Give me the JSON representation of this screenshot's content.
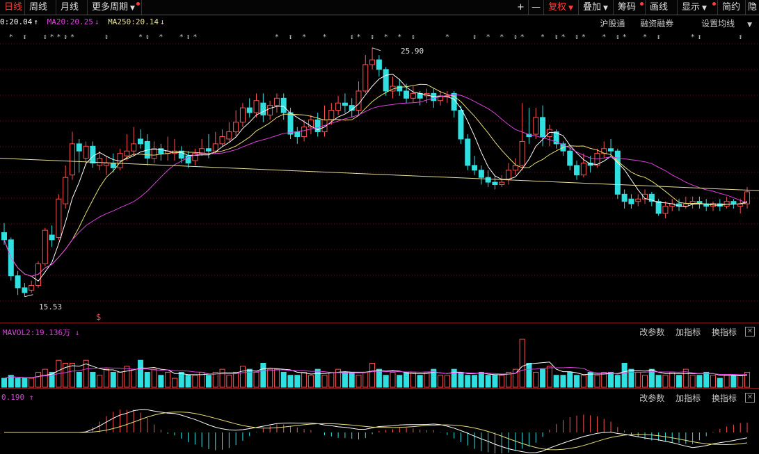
{
  "toolbar": {
    "left_tabs": [
      "日线",
      "周线",
      "月线",
      "更多周期"
    ],
    "right_tabs": [
      "+",
      "—",
      "复权",
      "叠加",
      "筹码",
      "画线",
      "显示",
      "简约",
      "隐"
    ]
  },
  "main_legend": {
    "ma5": "0:20.04",
    "ma20": "MA20:20.25",
    "ma250": "MA250:20.14",
    "arrow_up": "↑",
    "arrow_down": "↓"
  },
  "main_links": [
    "沪股通",
    "融资融券",
    "设置均线"
  ],
  "price_labels": {
    "high": "25.90",
    "low": "15.53"
  },
  "s_mark": "$",
  "vol_panel": {
    "label": "MAVOL2:19.136万",
    "arrow": "↓",
    "actions": [
      "改参数",
      "加指标",
      "换指标"
    ]
  },
  "ind_panel": {
    "label": "0.190",
    "arrow": "↑",
    "actions": [
      "改参数",
      "加指标",
      "换指标"
    ]
  },
  "colors": {
    "up": "#ff5050",
    "down": "#30e0e0",
    "ma5": "#ffffff",
    "ma10": "#e8e07a",
    "ma20": "#e040e0",
    "ma250": "#e8e0a0"
  },
  "chart_data": {
    "type": "candlestick",
    "candles": [
      [
        18.2,
        17.9,
        18.6,
        17.7
      ],
      [
        17.9,
        16.4,
        18.0,
        16.2
      ],
      [
        16.4,
        15.9,
        16.6,
        15.6
      ],
      [
        15.9,
        15.7,
        16.1,
        15.53
      ],
      [
        15.8,
        16.0,
        16.2,
        15.7
      ],
      [
        16.0,
        16.9,
        17.0,
        15.9
      ],
      [
        16.9,
        18.3,
        18.4,
        16.8
      ],
      [
        18.1,
        17.9,
        18.5,
        17.6
      ],
      [
        18.0,
        19.6,
        19.8,
        17.9
      ],
      [
        19.4,
        20.5,
        21.0,
        19.2
      ],
      [
        20.6,
        21.9,
        22.4,
        20.4
      ],
      [
        21.9,
        21.6,
        22.1,
        20.7
      ],
      [
        21.3,
        21.8,
        22.0,
        21.0
      ],
      [
        21.8,
        21.1,
        22.0,
        20.9
      ],
      [
        21.0,
        21.3,
        21.6,
        20.8
      ],
      [
        21.0,
        21.1,
        21.4,
        20.6
      ],
      [
        21.1,
        20.9,
        21.5,
        20.7
      ],
      [
        20.9,
        21.5,
        21.7,
        20.8
      ],
      [
        21.4,
        21.6,
        22.3,
        21.2
      ],
      [
        21.6,
        21.9,
        22.6,
        21.4
      ],
      [
        22.1,
        21.9,
        22.5,
        21.7
      ],
      [
        22.0,
        21.3,
        22.3,
        21.0
      ],
      [
        21.3,
        21.7,
        22.0,
        21.1
      ],
      [
        21.7,
        21.5,
        21.9,
        21.2
      ],
      [
        21.5,
        21.6,
        22.2,
        21.2
      ],
      [
        21.5,
        21.6,
        22.1,
        21.2
      ],
      [
        21.6,
        21.3,
        21.8,
        21.1
      ],
      [
        21.4,
        21.1,
        21.6,
        20.9
      ],
      [
        21.2,
        21.5,
        21.7,
        21.0
      ],
      [
        21.5,
        21.7,
        22.1,
        21.4
      ],
      [
        21.7,
        21.6,
        22.3,
        21.3
      ],
      [
        21.6,
        21.9,
        22.4,
        21.5
      ],
      [
        21.9,
        22.2,
        22.5,
        21.8
      ],
      [
        22.1,
        22.4,
        22.8,
        22.0
      ],
      [
        22.4,
        22.8,
        23.3,
        22.2
      ],
      [
        22.8,
        23.4,
        23.6,
        22.6
      ],
      [
        23.4,
        23.2,
        23.8,
        23.0
      ],
      [
        23.2,
        23.7,
        24.0,
        23.0
      ],
      [
        23.6,
        23.1,
        24.0,
        22.8
      ],
      [
        23.1,
        23.5,
        23.7,
        22.9
      ],
      [
        23.5,
        23.8,
        24.0,
        23.2
      ],
      [
        23.8,
        23.2,
        24.0,
        22.9
      ],
      [
        23.2,
        22.3,
        23.4,
        22.1
      ],
      [
        22.4,
        22.2,
        22.6,
        21.9
      ],
      [
        22.2,
        22.6,
        22.9,
        22.0
      ],
      [
        22.6,
        22.9,
        23.1,
        22.3
      ],
      [
        22.9,
        22.4,
        23.2,
        22.2
      ],
      [
        22.4,
        22.9,
        23.5,
        22.2
      ],
      [
        22.9,
        23.3,
        23.6,
        22.7
      ],
      [
        23.3,
        23.6,
        23.9,
        23.1
      ],
      [
        23.6,
        23.5,
        24.0,
        23.2
      ],
      [
        23.5,
        23.3,
        23.8,
        23.0
      ],
      [
        23.3,
        24.1,
        24.5,
        23.1
      ],
      [
        24.1,
        25.2,
        25.6,
        24.0
      ],
      [
        25.2,
        25.4,
        25.9,
        25.0
      ],
      [
        25.4,
        25.0,
        25.6,
        24.7
      ],
      [
        25.0,
        24.1,
        25.1,
        23.9
      ],
      [
        24.1,
        24.3,
        24.7,
        23.8
      ],
      [
        24.3,
        24.1,
        24.6,
        23.9
      ],
      [
        24.1,
        23.8,
        24.4,
        23.6
      ],
      [
        23.8,
        24.0,
        24.3,
        23.6
      ],
      [
        24.0,
        23.8,
        24.1,
        23.5
      ],
      [
        23.9,
        24.0,
        24.2,
        23.6
      ],
      [
        24.0,
        23.7,
        24.2,
        23.4
      ],
      [
        23.7,
        23.9,
        24.1,
        23.5
      ],
      [
        23.9,
        23.9,
        24.1,
        23.6
      ],
      [
        24.0,
        23.3,
        24.1,
        23.0
      ],
      [
        23.3,
        22.1,
        23.5,
        21.9
      ],
      [
        22.1,
        21.0,
        22.3,
        20.8
      ],
      [
        21.0,
        20.8,
        21.4,
        20.6
      ],
      [
        20.8,
        20.5,
        21.0,
        20.2
      ],
      [
        20.5,
        20.3,
        20.8,
        20.1
      ],
      [
        20.3,
        20.2,
        20.6,
        20.0
      ],
      [
        20.2,
        20.3,
        20.6,
        20.1
      ],
      [
        20.4,
        20.8,
        21.1,
        20.2
      ],
      [
        20.8,
        21.0,
        21.3,
        20.6
      ],
      [
        21.0,
        22.0,
        23.6,
        20.8
      ],
      [
        22.3,
        22.2,
        23.4,
        21.9
      ],
      [
        22.3,
        23.0,
        23.4,
        22.1
      ],
      [
        23.0,
        22.2,
        23.5,
        21.8
      ],
      [
        22.2,
        22.5,
        22.7,
        21.8
      ],
      [
        22.4,
        21.9,
        22.5,
        21.7
      ],
      [
        21.9,
        21.6,
        22.0,
        21.4
      ],
      [
        21.6,
        21.0,
        21.8,
        20.8
      ],
      [
        21.0,
        20.6,
        21.2,
        20.4
      ],
      [
        20.6,
        21.1,
        21.5,
        20.5
      ],
      [
        21.1,
        21.0,
        21.4,
        20.7
      ],
      [
        21.0,
        21.5,
        21.7,
        20.9
      ],
      [
        21.5,
        21.7,
        22.0,
        21.3
      ],
      [
        21.7,
        21.6,
        22.1,
        21.4
      ],
      [
        21.6,
        19.8,
        21.7,
        19.6
      ],
      [
        19.8,
        19.5,
        20.0,
        19.2
      ],
      [
        19.6,
        19.4,
        19.8,
        19.2
      ],
      [
        19.5,
        19.6,
        19.8,
        19.3
      ],
      [
        19.6,
        19.8,
        20.0,
        19.4
      ],
      [
        19.8,
        19.5,
        19.9,
        19.3
      ],
      [
        19.5,
        19.0,
        19.6,
        18.9
      ],
      [
        19.0,
        19.3,
        19.5,
        18.8
      ],
      [
        19.3,
        19.4,
        19.6,
        19.1
      ],
      [
        19.4,
        19.3,
        19.6,
        19.1
      ],
      [
        19.3,
        19.4,
        19.7,
        19.2
      ],
      [
        19.4,
        19.5,
        19.7,
        19.2
      ],
      [
        19.5,
        19.4,
        19.7,
        19.2
      ],
      [
        19.4,
        19.3,
        19.6,
        19.1
      ],
      [
        19.3,
        19.4,
        19.5,
        19.1
      ],
      [
        19.4,
        19.3,
        19.6,
        19.1
      ],
      [
        19.3,
        19.5,
        19.7,
        19.2
      ],
      [
        19.5,
        19.4,
        19.6,
        19.2
      ],
      [
        19.3,
        19.4,
        19.6,
        19.0
      ],
      [
        19.4,
        19.9,
        20.1,
        19.2
      ]
    ],
    "price_axis": [
      15.0,
      26.3
    ],
    "volumes": [
      3,
      4,
      3,
      3,
      3,
      5,
      6,
      5,
      9,
      8,
      8,
      5,
      9,
      5,
      4,
      6,
      5,
      5,
      7,
      6,
      9,
      5,
      6,
      4,
      5,
      3,
      5,
      4,
      4,
      5,
      4,
      5,
      6,
      4,
      5,
      7,
      6,
      5,
      8,
      6,
      6,
      5,
      4,
      4,
      5,
      4,
      6,
      4,
      5,
      6,
      5,
      5,
      4,
      5,
      8,
      6,
      4,
      5,
      4,
      5,
      5,
      4,
      5,
      6,
      4,
      4,
      6,
      5,
      4,
      4,
      5,
      4,
      4,
      4,
      5,
      6,
      16,
      8,
      5,
      6,
      7,
      4,
      4,
      5,
      4,
      4,
      5,
      4,
      5,
      5,
      4,
      8,
      6,
      5,
      4,
      6,
      4,
      4,
      5,
      4,
      6,
      4,
      4,
      5,
      4,
      3,
      4,
      4,
      4,
      5
    ]
  }
}
